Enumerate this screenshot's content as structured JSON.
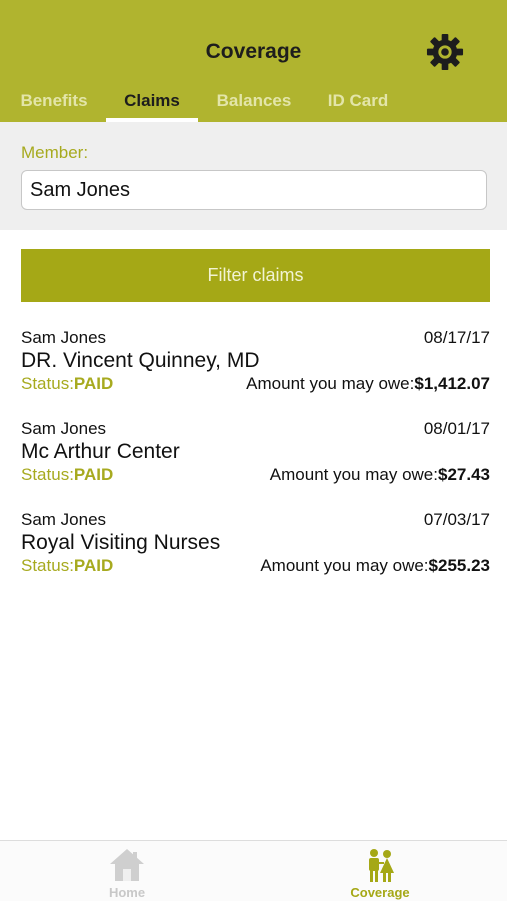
{
  "header": {
    "title": "Coverage",
    "settings_icon": "gear-icon",
    "tabs": [
      {
        "label": "Benefits",
        "active": false
      },
      {
        "label": "Claims",
        "active": true
      },
      {
        "label": "Balances",
        "active": false
      },
      {
        "label": "ID Card",
        "active": false
      }
    ]
  },
  "member_filter": {
    "label": "Member:",
    "value": "Sam Jones",
    "button_label": "Filter claims"
  },
  "claims": [
    {
      "member": "Sam Jones",
      "date": "08/17/17",
      "provider": "DR. Vincent Quinney, MD",
      "status_label": "Status:",
      "status": "PAID",
      "owe_label": "Amount you may owe:",
      "owe_amount": "$1,412.07"
    },
    {
      "member": "Sam Jones",
      "date": "08/01/17",
      "provider": "Mc Arthur Center",
      "status_label": "Status:",
      "status": "PAID",
      "owe_label": "Amount you may owe:",
      "owe_amount": "$27.43"
    },
    {
      "member": "Sam Jones",
      "date": "07/03/17",
      "provider": "Royal Visiting Nurses",
      "status_label": "Status:",
      "status": "PAID",
      "owe_label": "Amount you may owe:",
      "owe_amount": "$255.23"
    }
  ],
  "tab_bar": {
    "items": [
      {
        "label": "Home",
        "icon": "house-icon",
        "active": false
      },
      {
        "label": "Coverage",
        "icon": "family-icon",
        "active": true
      }
    ]
  },
  "colors": {
    "header": "#b0b42f",
    "accent": "#a7aa1f",
    "button": "#a5a816",
    "inactive_tab_text": "#e3e5a9",
    "inactive_tabbar": "#c8c8c8"
  }
}
